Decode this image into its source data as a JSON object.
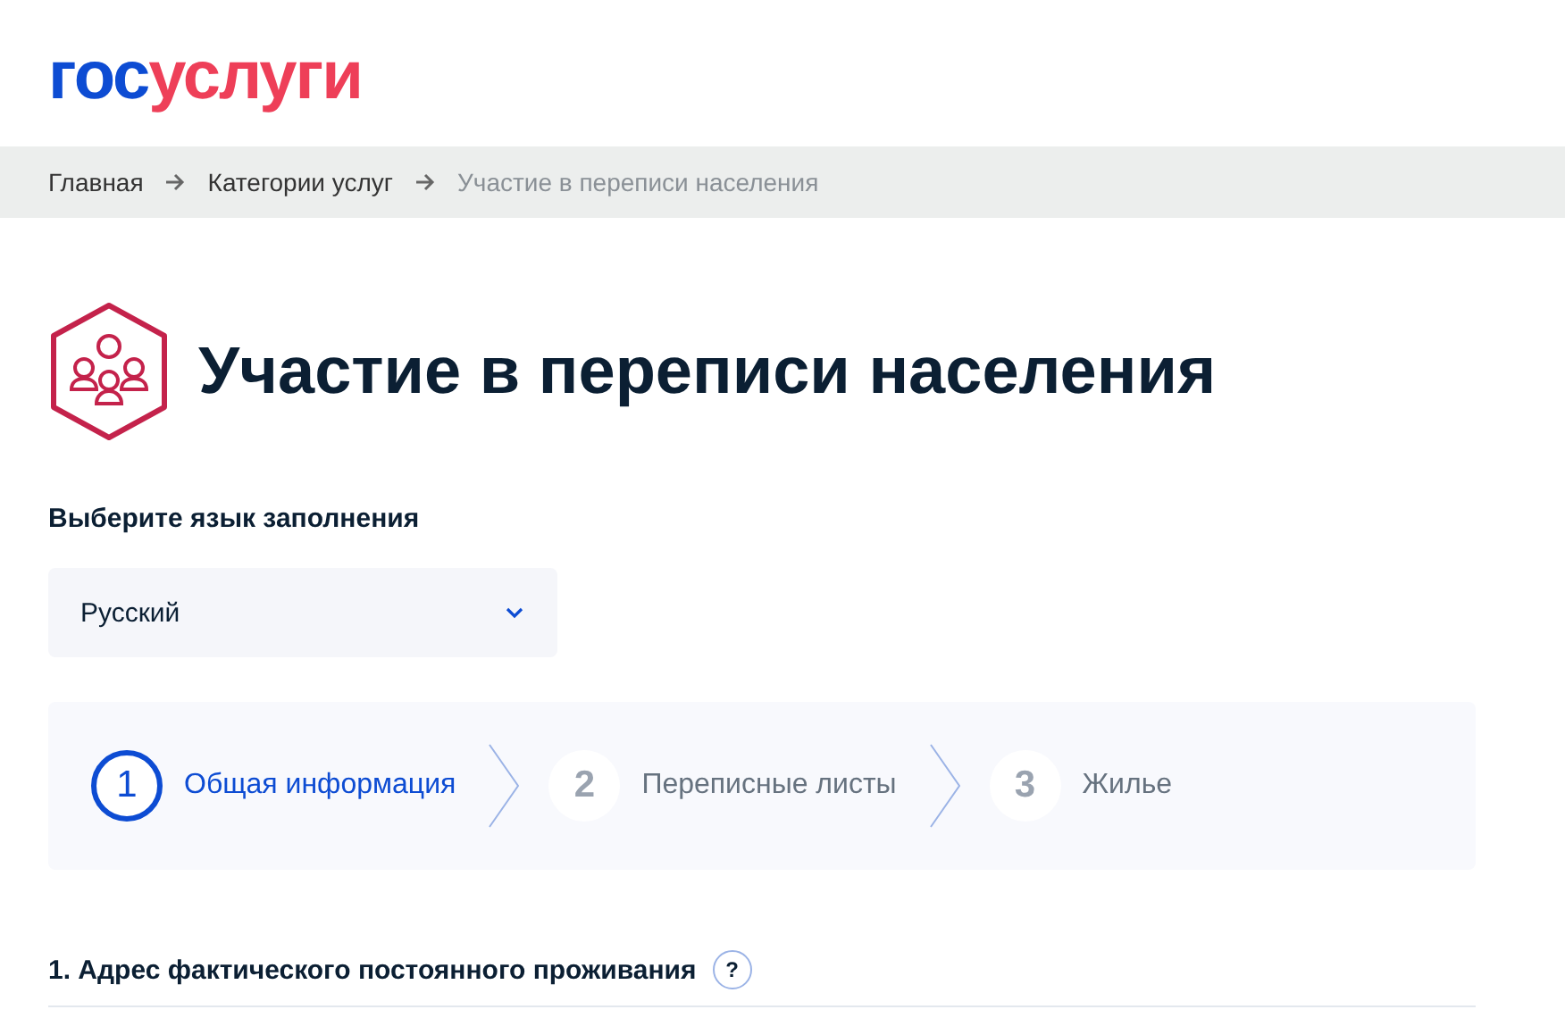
{
  "logo": {
    "part_1": "гос",
    "part_2": "услуги"
  },
  "breadcrumbs": [
    {
      "label": "Главная",
      "current": false
    },
    {
      "label": "Категории услуг",
      "current": false
    },
    {
      "label": "Участие в переписи населения",
      "current": true
    }
  ],
  "title": "Участие в переписи населения",
  "language": {
    "label": "Выберите язык заполнения",
    "value": "Русский"
  },
  "steps": [
    {
      "number": "1",
      "label": "Общая информация",
      "selected": true
    },
    {
      "number": "2",
      "label": "Переписные листы",
      "selected": false
    },
    {
      "number": "3",
      "label": "Жилье",
      "selected": false
    }
  ],
  "question": {
    "label": "1. Адрес фактического постоянного проживания",
    "help": "?"
  }
}
